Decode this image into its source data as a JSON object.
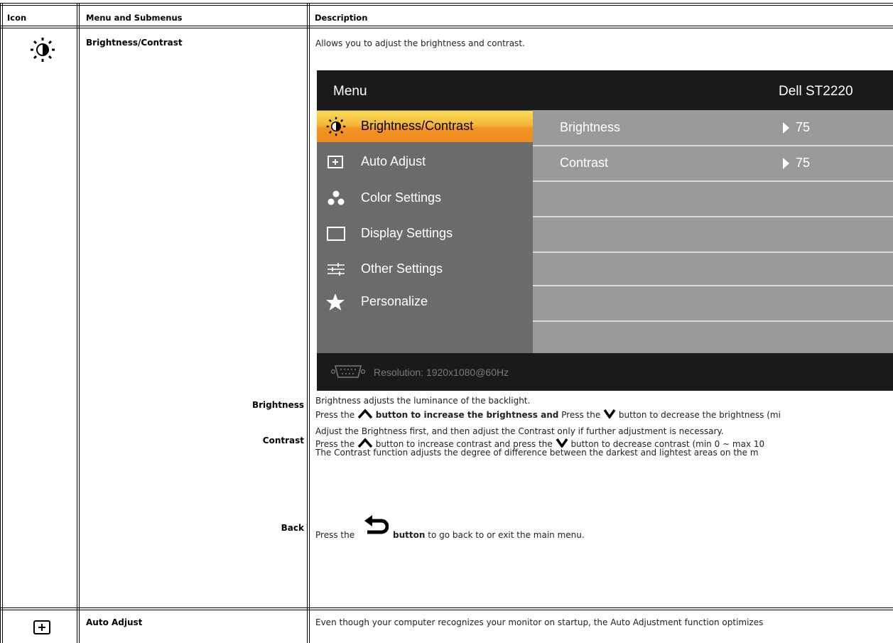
{
  "table": {
    "headers": {
      "icon": "Icon",
      "menu": "Menu and Submenus",
      "description": "Description"
    },
    "rows": {
      "brightness_contrast": {
        "icon": "brightness-contrast-icon",
        "name": "Brightness/Contrast",
        "description": "Allows you to adjust the brightness and contrast."
      },
      "brightness": {
        "label": "Brightness",
        "line1": "Brightness adjusts the luminance of the backlight.",
        "line2_a": "Press the",
        "line2_b": "button to increase the brightness and",
        "line2_c": "Press the",
        "line2_d": "button to decrease the brightness (mi"
      },
      "contrast": {
        "label": "Contrast",
        "line1": "Adjust the Brightness first, and then adjust the Contrast only if further adjustment is necessary.",
        "line2_a": "Press the",
        "line2_b": "button to increase contrast and press the",
        "line2_c": "button to decrease contrast (min 0 ~ max 10",
        "line3": "The Contrast function adjusts the degree of difference between the darkest and lightest areas on the m"
      },
      "back": {
        "label": "Back",
        "text_a": "Press the",
        "text_b": "button",
        "text_c": "to go back to or exit the main menu."
      },
      "auto_adjust": {
        "icon": "auto-adjust-icon",
        "name": "Auto Adjust",
        "description": "Even though your computer recognizes your monitor on startup, the Auto Adjustment function optimizes"
      }
    }
  },
  "osd": {
    "title": "Menu",
    "model": "Dell ST2220",
    "menu_items": [
      {
        "label": "Brightness/Contrast",
        "icon": "brightness-contrast-icon",
        "selected": true
      },
      {
        "label": "Auto Adjust",
        "icon": "auto-adjust-icon"
      },
      {
        "label": "Color Settings",
        "icon": "color-settings-icon"
      },
      {
        "label": "Display Settings",
        "icon": "display-settings-icon"
      },
      {
        "label": "Other Settings",
        "icon": "other-settings-icon"
      },
      {
        "label": "Personalize",
        "icon": "star-icon"
      }
    ],
    "settings": [
      {
        "label": "Brightness",
        "value": "75"
      },
      {
        "label": "Contrast",
        "value": "75"
      }
    ],
    "resolution": "Resolution:  1920x1080@60Hz",
    "colors": {
      "selected_top": "#f9dd5a",
      "selected_bottom": "#f08a1e",
      "left_panel": "#6b6b6b",
      "right_panel": "#9a9a9a"
    }
  }
}
